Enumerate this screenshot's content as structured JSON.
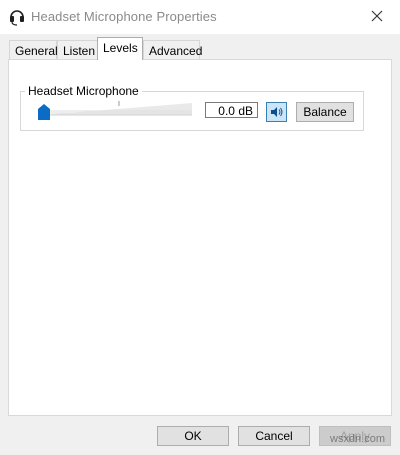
{
  "window": {
    "title": "Headset Microphone Properties"
  },
  "tabs": [
    {
      "label": "General"
    },
    {
      "label": "Listen"
    },
    {
      "label": "Levels"
    },
    {
      "label": "Advanced"
    }
  ],
  "active_tab": "Levels",
  "levels": {
    "group_label": "Headset Microphone",
    "level_value": "0.0 dB",
    "slider_level_percent": 0,
    "balance_label": "Balance"
  },
  "footer": {
    "ok_label": "OK",
    "cancel_label": "Cancel",
    "apply_label": "Apply"
  },
  "watermark": "wsxdn.com",
  "icons": {
    "title": "headset-icon",
    "close": "close-icon",
    "mute": "speaker-icon"
  }
}
